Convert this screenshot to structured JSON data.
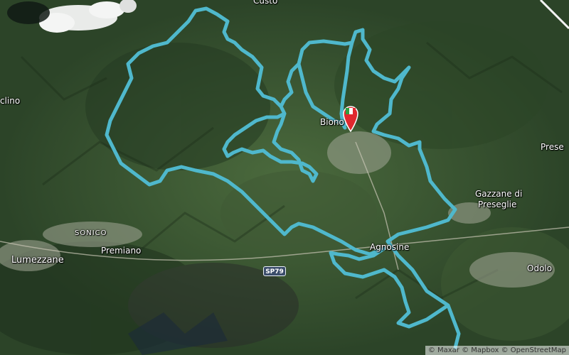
{
  "map": {
    "labels": {
      "custo": "Custo",
      "cinclino": "clino",
      "biono": "Biono",
      "presegno": "Prese",
      "gazzane_line1": "Gazzane di",
      "gazzane_line2": "Preseglie",
      "sonico": "SONICO",
      "premiano": "Premiano",
      "lumezzane": "Lumezzane",
      "agnosine": "Agnosine",
      "odolo": "Odolo"
    },
    "road_shield": "SP79",
    "attribution": "© Maxar © Mapbox © OpenStreetMap",
    "colors": {
      "route": "#4fb8cc",
      "terrain": "#34502d",
      "marker_red": "#e0282e",
      "marker_green": "#2e9e3e"
    }
  }
}
